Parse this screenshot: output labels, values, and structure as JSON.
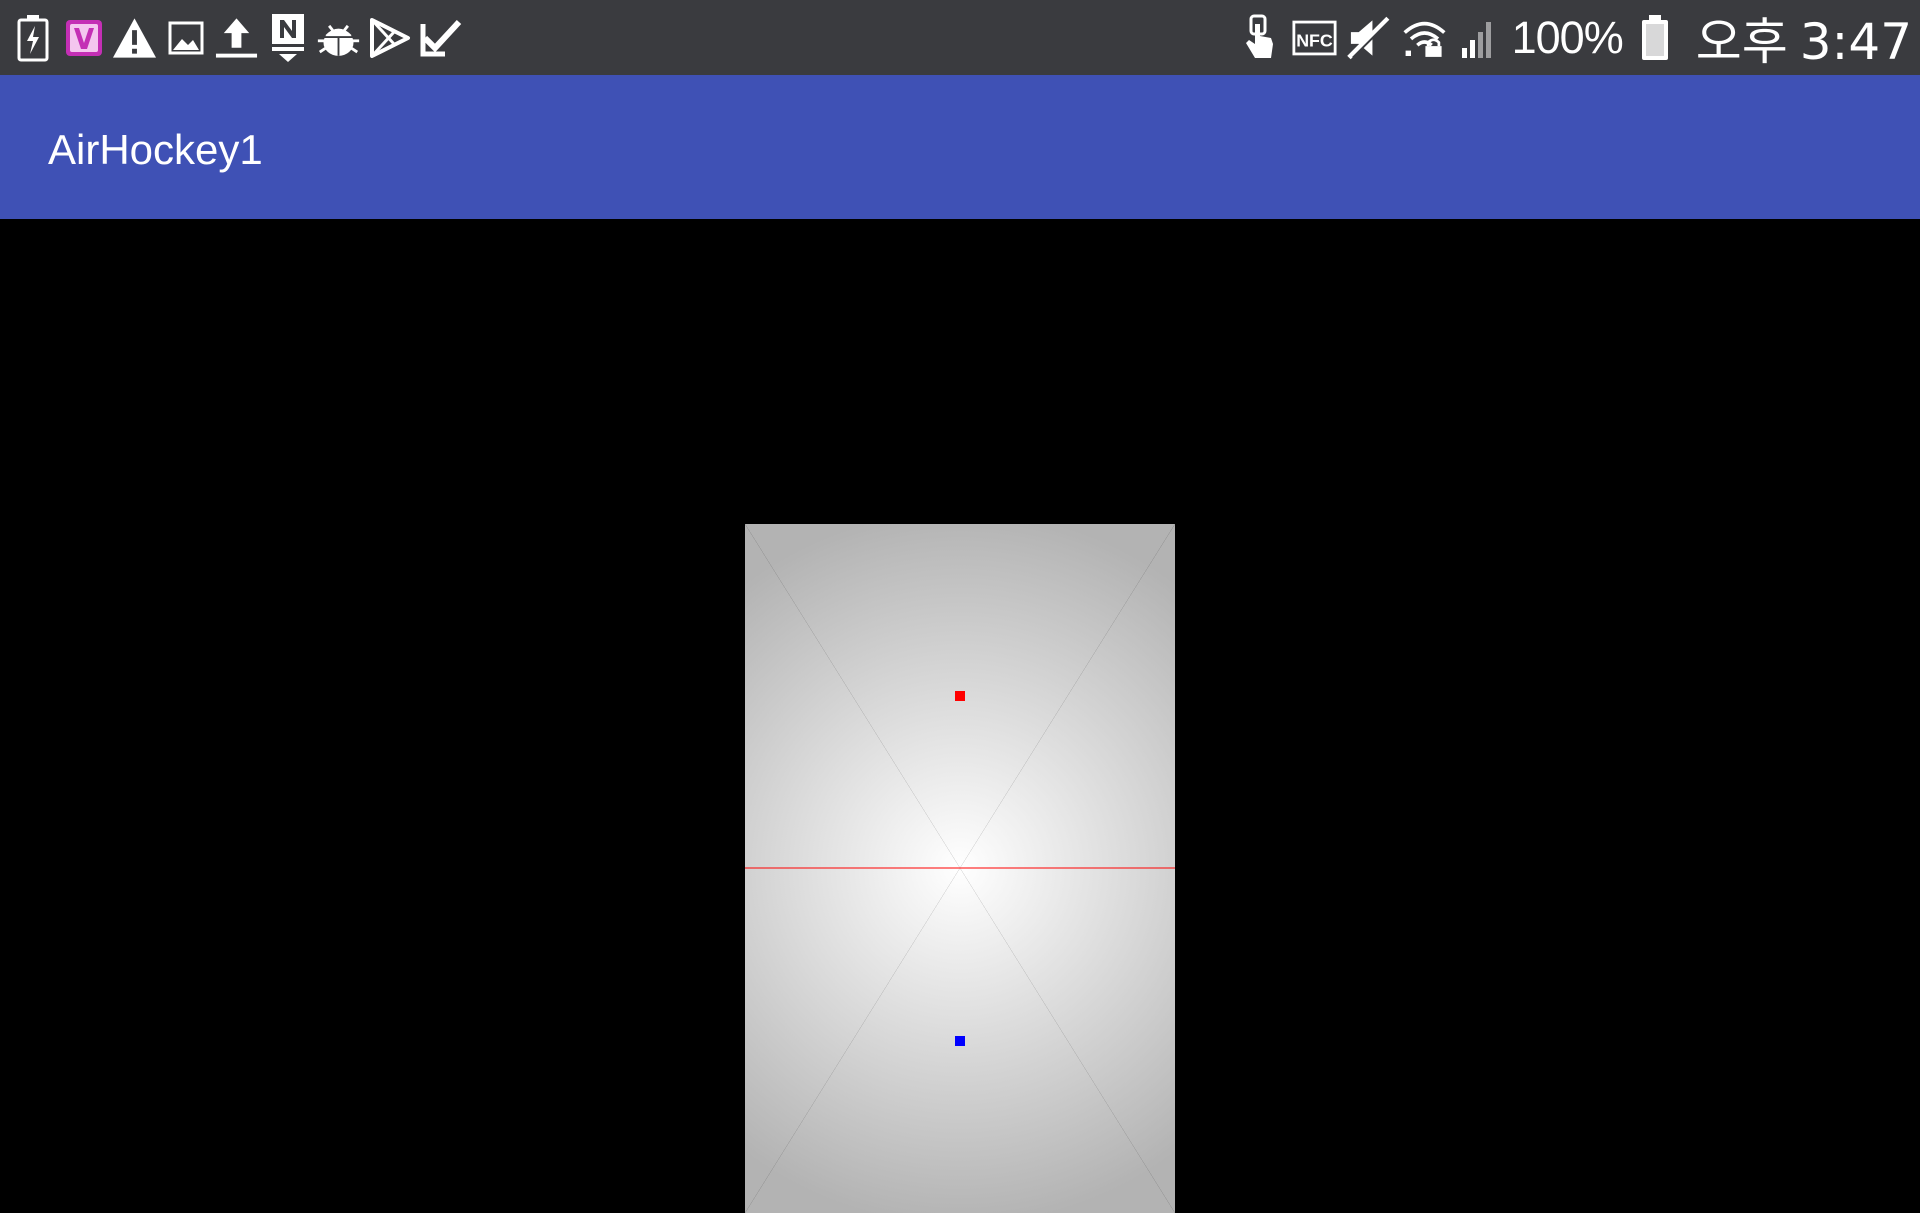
{
  "status_bar": {
    "left_icons": [
      "battery-charging-icon",
      "v-app-icon",
      "warning-icon",
      "image-icon",
      "upload-icon",
      "n-app-icon",
      "bug-icon",
      "play-store-icon",
      "task-check-icon"
    ],
    "right_icons": [
      "touch-icon",
      "nfc-icon",
      "mute-icon",
      "wifi-lock-icon",
      "signal-icon",
      "battery-icon"
    ],
    "battery_percent": "100%",
    "clock_ampm": "오후",
    "clock_time": "3:47"
  },
  "app_bar": {
    "title": "AirHockey1",
    "color": "#3f51b5"
  },
  "scene": {
    "background": "#000000",
    "table": {
      "center_color": "#ffffff",
      "edge_color": "#b3b3b3"
    },
    "center_line": {
      "color": "#ff0000"
    },
    "mallets": [
      {
        "name": "red-mallet",
        "color": "#ff0000"
      },
      {
        "name": "blue-mallet",
        "color": "#0000ff"
      }
    ]
  }
}
